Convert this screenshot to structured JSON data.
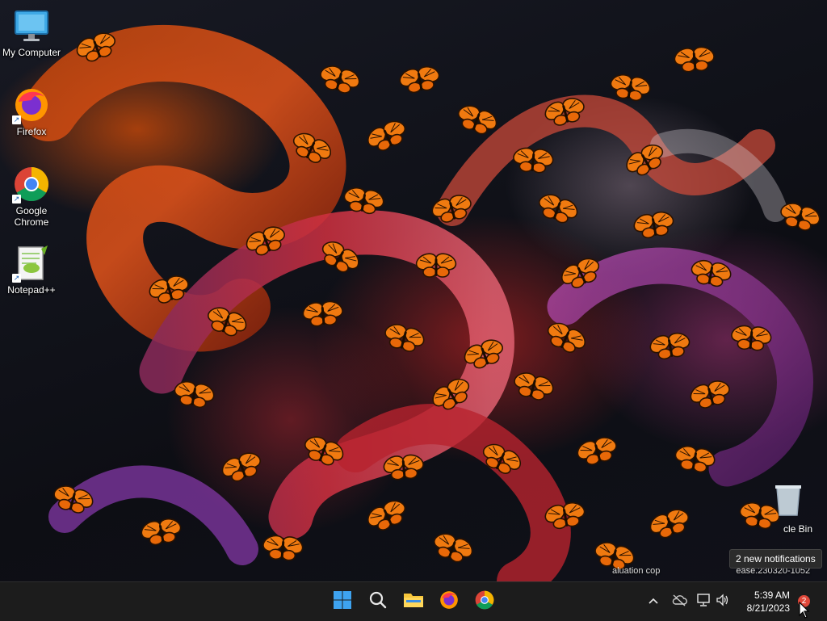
{
  "desktop": {
    "icons": [
      {
        "label": "My Computer",
        "icon": "monitor-icon"
      },
      {
        "label": "Firefox",
        "icon": "firefox-icon"
      },
      {
        "label": "Google\nChrome",
        "icon": "chrome-icon"
      },
      {
        "label": "Notepad++",
        "icon": "notepadpp-icon"
      }
    ],
    "recycle_bin_label": "cle Bin",
    "watermark": {
      "left": "aluation cop",
      "right": "ease.230320-1052"
    }
  },
  "notification_tooltip": "2 new notifications",
  "taskbar": {
    "apps": [
      {
        "name": "Start",
        "icon": "windows-start-icon"
      },
      {
        "name": "Search",
        "icon": "search-icon"
      },
      {
        "name": "File Explorer",
        "icon": "folder-icon"
      },
      {
        "name": "Firefox",
        "icon": "firefox-icon"
      },
      {
        "name": "Google Chrome",
        "icon": "chrome-icon"
      }
    ],
    "tray": {
      "overflow_glyph": "^",
      "icons": [
        "chevron-up-icon",
        "cloud-offline-icon",
        "network-icon",
        "volume-icon"
      ]
    },
    "clock": {
      "time": "5:39 AM",
      "date": "8/21/2023"
    },
    "notification_count": "2"
  },
  "colors": {
    "taskbar_bg": "#1c1c1c",
    "badge": "#e0483a",
    "butterfly_orange": "#f07a10",
    "start_blue": "#3ea3f0"
  }
}
